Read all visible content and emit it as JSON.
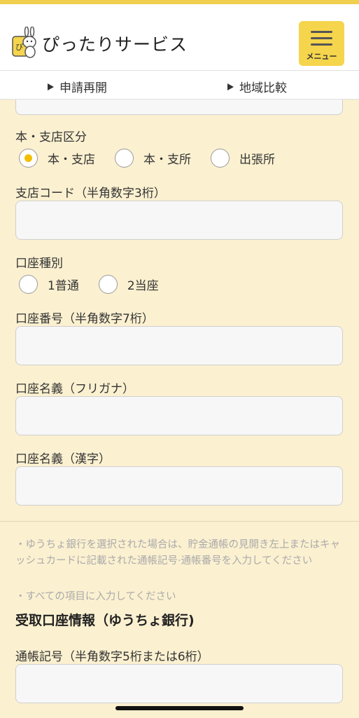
{
  "header": {
    "app_title": "ぴったりサービス",
    "logo_text": "ぴ",
    "menu_label": "メニュー",
    "accent_color": "#f5d54c"
  },
  "subnav": {
    "items": [
      {
        "label": "申請再開"
      },
      {
        "label": "地域比較"
      }
    ]
  },
  "form": {
    "branch_type": {
      "label": "本・支店区分",
      "options": [
        "本・支店",
        "本・支所",
        "出張所"
      ],
      "selected": "本・支店"
    },
    "branch_code": {
      "label": "支店コード（半角数字3桁）",
      "value": "",
      "placeholder": ""
    },
    "account_type": {
      "label": "口座種別",
      "options": [
        "1普通",
        "2当座"
      ],
      "selected": ""
    },
    "account_number": {
      "label": "口座番号（半角数字7桁）",
      "value": "",
      "placeholder": ""
    },
    "account_name_kana": {
      "label": "口座名義（フリガナ）",
      "value": "",
      "placeholder": ""
    },
    "account_name_kanji": {
      "label": "口座名義（漢字）",
      "value": "",
      "placeholder": ""
    }
  },
  "notes": {
    "line1": "・ゆうちょ銀行を選択された場合は、貯金通帳の見開き左上またはキャッシュカードに記載された通帳記号·通帳番号を入力してください",
    "line2": "・すべての項目に入力してください"
  },
  "yucho_section": {
    "title": "受取口座情報（ゆうちょ銀行)",
    "passbook_symbol": {
      "label": "通帳記号（半角数字5桁または6桁）",
      "value": "",
      "placeholder": ""
    }
  }
}
